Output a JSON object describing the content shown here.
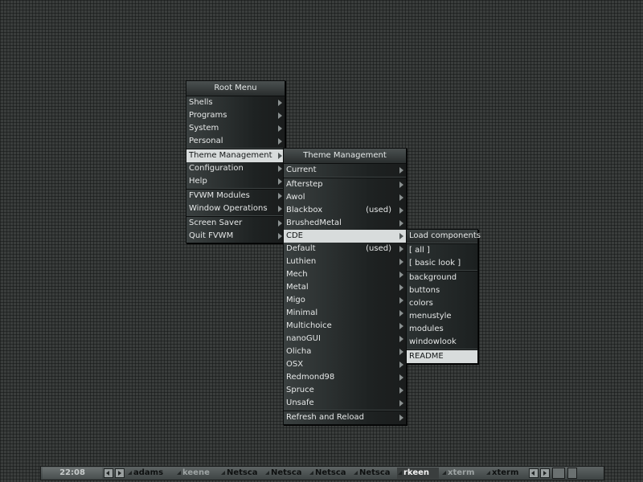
{
  "root_menu": {
    "title": "Root Menu",
    "items": [
      {
        "label": "Shells"
      },
      {
        "label": "Programs"
      },
      {
        "label": "System"
      },
      {
        "label": "Personal"
      },
      {
        "label": "Theme Management"
      },
      {
        "label": "Configuration"
      },
      {
        "label": "Help"
      },
      {
        "label": "FVWM Modules"
      },
      {
        "label": "Window Operations"
      },
      {
        "label": "Screen Saver"
      },
      {
        "label": "Quit FVWM"
      }
    ]
  },
  "theme_menu": {
    "title": "Theme Management",
    "items": [
      {
        "label": "Current"
      },
      {
        "label": "Afterstep"
      },
      {
        "label": "Awol"
      },
      {
        "label": "Blackbox",
        "note": "(used)"
      },
      {
        "label": "BrushedMetal"
      },
      {
        "label": "CDE"
      },
      {
        "label": "Default",
        "note": "(used)"
      },
      {
        "label": "Luthien"
      },
      {
        "label": "Mech"
      },
      {
        "label": "Metal"
      },
      {
        "label": "Migo"
      },
      {
        "label": "Minimal"
      },
      {
        "label": "Multichoice"
      },
      {
        "label": "nanoGUI"
      },
      {
        "label": "Olicha"
      },
      {
        "label": "OSX"
      },
      {
        "label": "Redmond98"
      },
      {
        "label": "Spruce"
      },
      {
        "label": "Unsafe"
      },
      {
        "label": "Refresh and Reload"
      }
    ]
  },
  "cde_menu": {
    "title": "Load components",
    "items": [
      {
        "label": "[ all ]"
      },
      {
        "label": "[ basic look ]"
      },
      {
        "label": "background"
      },
      {
        "label": "buttons"
      },
      {
        "label": "colors"
      },
      {
        "label": "menustyle"
      },
      {
        "label": "modules"
      },
      {
        "label": "windowlook"
      },
      {
        "label": "README"
      }
    ]
  },
  "taskbar": {
    "clock": "22:08",
    "tasks": [
      {
        "label": "adams"
      },
      {
        "label": "keene"
      },
      {
        "label": "Netsca"
      },
      {
        "label": "Netsca"
      },
      {
        "label": "Netsca"
      },
      {
        "label": "Netsca"
      },
      {
        "label": "rkeen"
      },
      {
        "label": "xterm"
      },
      {
        "label": "xterm"
      }
    ]
  }
}
